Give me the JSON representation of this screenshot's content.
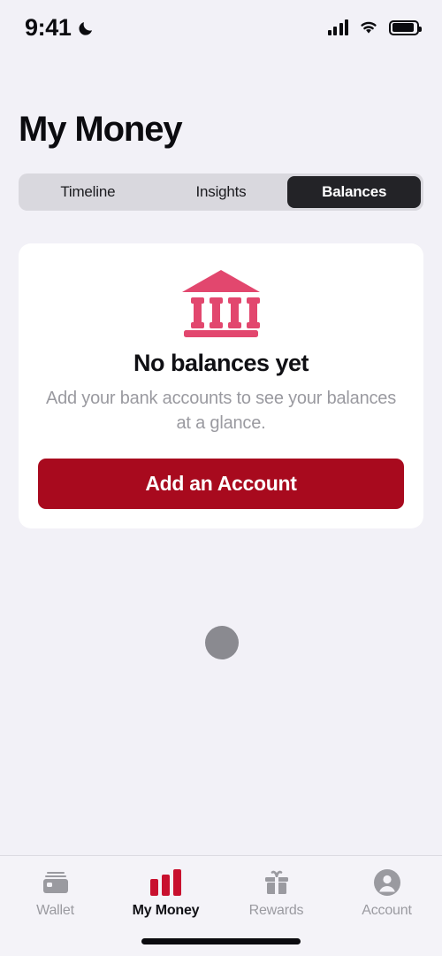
{
  "status_bar": {
    "time": "9:41",
    "moon_icon": "crescent-moon-icon",
    "signal_icon": "cellular-signal-icon",
    "wifi_icon": "wifi-icon",
    "battery_icon": "battery-icon"
  },
  "header": {
    "title": "My Money"
  },
  "segmented_control": {
    "segments": [
      {
        "label": "Timeline",
        "selected": false
      },
      {
        "label": "Insights",
        "selected": false
      },
      {
        "label": "Balances",
        "selected": true
      }
    ]
  },
  "empty_state": {
    "icon": "bank-building-icon",
    "icon_color": "#E2476E",
    "title": "No balances yet",
    "subtitle": "Add your bank accounts to see your balances at a glance.",
    "cta_label": "Add an Account",
    "cta_color": "#A80A1E"
  },
  "loading_dot": {
    "name": "loading-indicator",
    "color": "#8A8A90"
  },
  "tab_bar": {
    "active_color": "#C8102E",
    "inactive_color": "#9A9AA0",
    "tabs": [
      {
        "label": "Wallet",
        "icon": "wallet-card-icon",
        "active": false
      },
      {
        "label": "My Money",
        "icon": "bar-chart-icon",
        "active": true
      },
      {
        "label": "Rewards",
        "icon": "gift-icon",
        "active": false
      },
      {
        "label": "Account",
        "icon": "person-circle-icon",
        "active": false
      }
    ]
  }
}
